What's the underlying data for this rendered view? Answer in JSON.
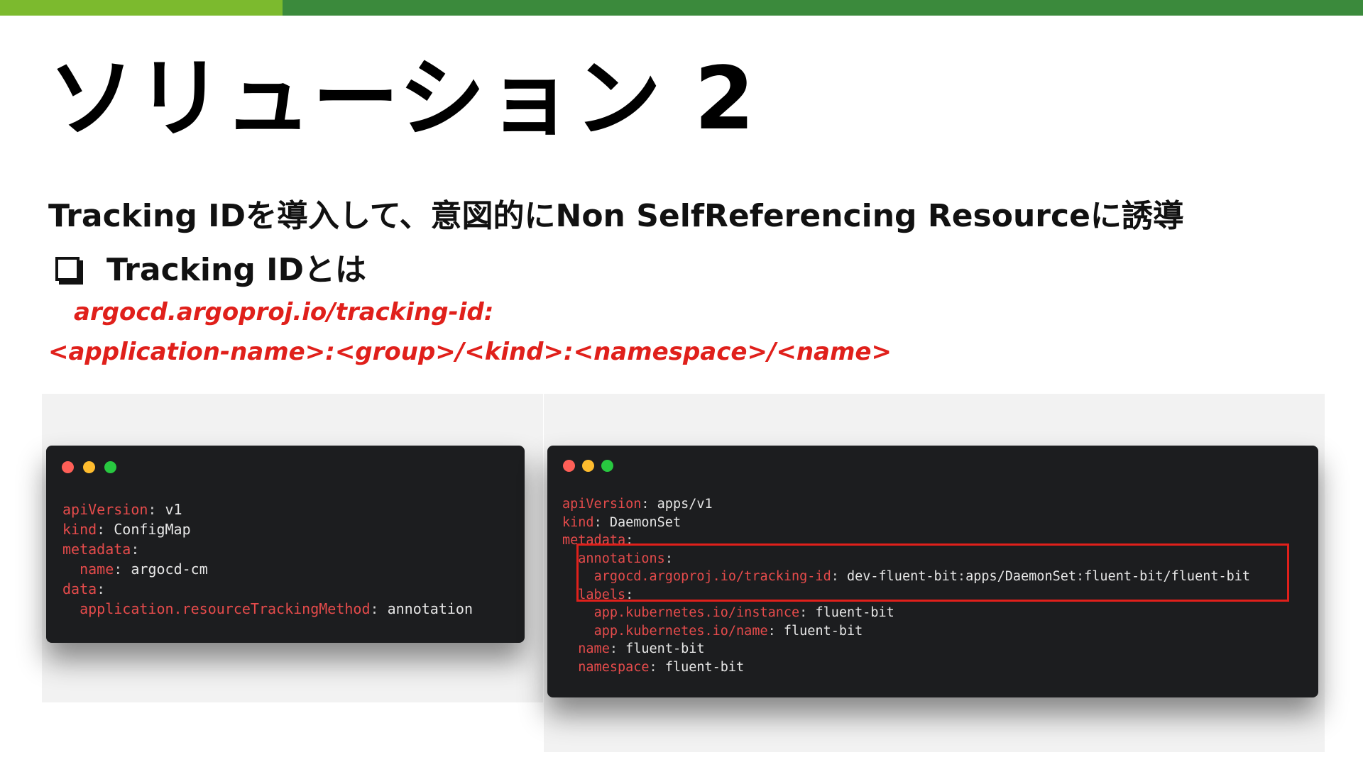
{
  "slide": {
    "title": "ソリューション 2",
    "subtitle": "Tracking IDを導入して、意図的にNon SelfReferencing Resourceに誘導",
    "bullet": "Tracking IDとは",
    "format_line1": "argocd.argoproj.io/tracking-id:",
    "format_line2": "<application-name>:<group>/<kind>:<namespace>/<name>"
  },
  "code_left": {
    "lines": [
      {
        "k": "apiVersion",
        "v": "v1"
      },
      {
        "k": "kind",
        "v": "ConfigMap"
      },
      {
        "k": "metadata",
        "v": ""
      },
      {
        "k": "name",
        "v": "argocd-cm"
      },
      {
        "k": "data",
        "v": ""
      },
      {
        "k": "application.resourceTrackingMethod",
        "v": "annotation"
      }
    ]
  },
  "code_right": {
    "lines": [
      {
        "k": "apiVersion",
        "v": "apps/v1"
      },
      {
        "k": "kind",
        "v": "DaemonSet"
      },
      {
        "k": "metadata",
        "v": ""
      },
      {
        "k": "annotations",
        "v": ""
      },
      {
        "k": "argocd.argoproj.io/tracking-id",
        "v1": "dev-fluent-bit",
        "v2": "apps/DaemonSet",
        "v3": "fluent-bit/fluent-bit"
      },
      {
        "k": "labels",
        "v": ""
      },
      {
        "k": "app.kubernetes.io/instance",
        "v": "fluent-bit"
      },
      {
        "k": "app.kubernetes.io/name",
        "v": "fluent-bit"
      },
      {
        "k": "name",
        "v": "fluent-bit"
      },
      {
        "k": "namespace",
        "v": "fluent-bit"
      }
    ]
  }
}
